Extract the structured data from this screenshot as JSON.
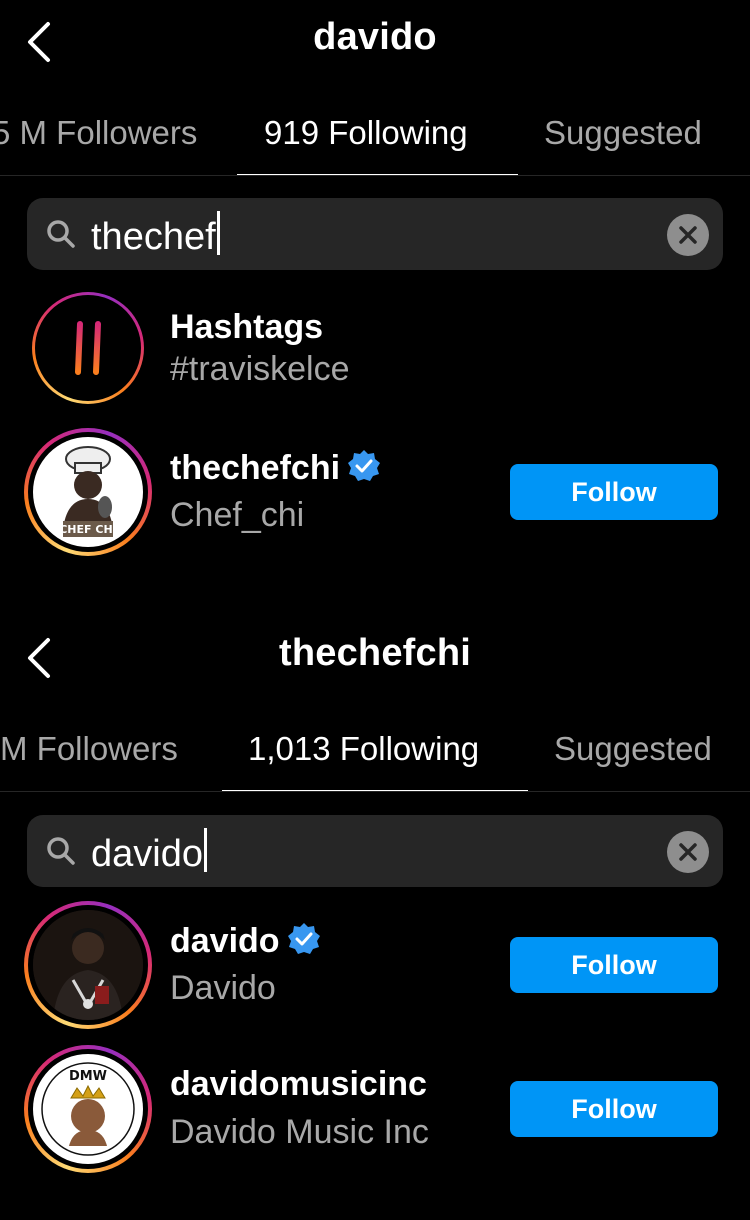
{
  "panel1": {
    "title": "davido",
    "tabs": [
      {
        "label": "5 M Followers",
        "active": false
      },
      {
        "label": "919 Following",
        "active": true
      },
      {
        "label": "Suggested",
        "active": false
      }
    ],
    "search": {
      "query": "thechef"
    },
    "results": [
      {
        "type": "hashtag",
        "name": "Hashtags",
        "sub": "#traviskelce"
      },
      {
        "type": "user",
        "name": "thechefchi",
        "sub": "Chef_chi",
        "verified": true,
        "button": "Follow",
        "avatar_icon": "chef-avatar-icon",
        "avatar_text": "CHEF CHI"
      }
    ]
  },
  "panel2": {
    "title": "thechefchi",
    "tabs": [
      {
        "label": "M Followers",
        "active": false
      },
      {
        "label": "1,013 Following",
        "active": true
      },
      {
        "label": "Suggested",
        "active": false
      }
    ],
    "search": {
      "query": "davido"
    },
    "results": [
      {
        "type": "user",
        "name": "davido",
        "sub": "Davido",
        "verified": true,
        "button": "Follow",
        "avatar_icon": "person-photo-icon"
      },
      {
        "type": "user",
        "name": "davidomusicinc",
        "sub": "Davido Music Inc",
        "verified": false,
        "button": "Follow",
        "avatar_icon": "dmw-logo-icon",
        "avatar_text": "DMW"
      }
    ]
  },
  "colors": {
    "background": "#000000",
    "accent": "#0095f6",
    "search_bg": "#262626",
    "secondary_text": "#a8a8a8",
    "verified": "#3897f0"
  }
}
